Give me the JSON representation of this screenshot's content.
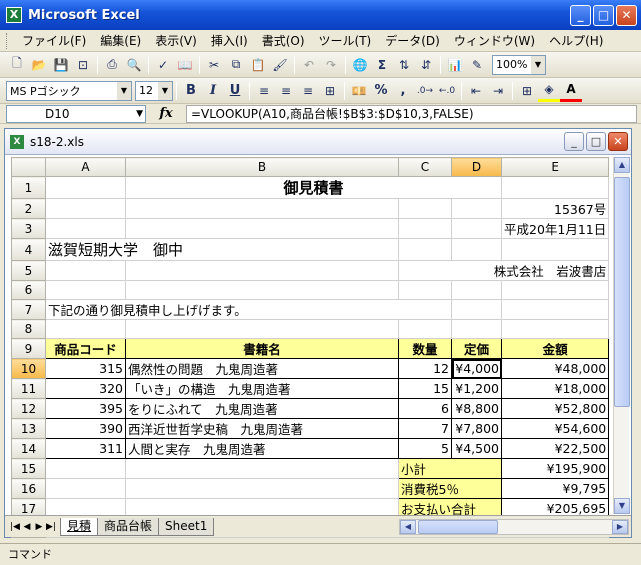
{
  "app": {
    "title": "Microsoft Excel",
    "icon_letter": "X"
  },
  "window_buttons": {
    "minimize": "_",
    "maximize": "□",
    "close": "✕"
  },
  "menu": [
    "ファイル(F)",
    "編集(E)",
    "表示(V)",
    "挿入(I)",
    "書式(O)",
    "ツール(T)",
    "データ(D)",
    "ウィンドウ(W)",
    "ヘルプ(H)"
  ],
  "toolbar": {
    "zoom": "100%"
  },
  "format_toolbar": {
    "font": "MS Pゴシック",
    "size": "12",
    "bold": "B",
    "italic": "I",
    "underline": "U",
    "percent": "%",
    "comma": ","
  },
  "formula_bar": {
    "name_box": "D10",
    "fx": "fx",
    "formula": "=VLOOKUP(A10,商品台帳!$B$3:$D$10,3,FALSE)"
  },
  "workbook": {
    "filename": "s18-2.xls"
  },
  "columns": [
    "A",
    "B",
    "C",
    "D",
    "E"
  ],
  "active": {
    "row": 10,
    "col": "D"
  },
  "sheet": {
    "title": "御見積書",
    "number": "15367号",
    "date": "平成20年1月11日",
    "customer": "滋賀短期大学　御中",
    "company": "株式会社　岩波書店",
    "greeting": "下記の通り御見積申し上げげます。",
    "headers": [
      "商品コード",
      "書籍名",
      "数量",
      "定価",
      "金額"
    ],
    "items": [
      {
        "code": "315",
        "name": "偶然性の問題　九鬼周造著",
        "qty": "12",
        "price": "¥4,000",
        "amount": "¥48,000"
      },
      {
        "code": "320",
        "name": "「いき」の構造　九鬼周造著",
        "qty": "15",
        "price": "¥1,200",
        "amount": "¥18,000"
      },
      {
        "code": "395",
        "name": "をりにふれて　九鬼周造著",
        "qty": "6",
        "price": "¥8,800",
        "amount": "¥52,800"
      },
      {
        "code": "390",
        "name": "西洋近世哲学史稿　九鬼周造著",
        "qty": "7",
        "price": "¥7,800",
        "amount": "¥54,600"
      },
      {
        "code": "311",
        "name": "人間と実存　九鬼周造著",
        "qty": "5",
        "price": "¥4,500",
        "amount": "¥22,500"
      }
    ],
    "subtotal_label": "小計",
    "subtotal": "¥195,900",
    "tax_label": "消費税5％",
    "tax": "¥9,795",
    "total_label": "お支払い合計",
    "total": "¥205,695"
  },
  "rows": [
    "1",
    "2",
    "3",
    "4",
    "5",
    "6",
    "7",
    "8",
    "9",
    "10",
    "11",
    "12",
    "13",
    "14",
    "15",
    "16",
    "17",
    "18"
  ],
  "tabs": [
    "見積",
    "商品台帳",
    "Sheet1"
  ],
  "status": "コマンド"
}
